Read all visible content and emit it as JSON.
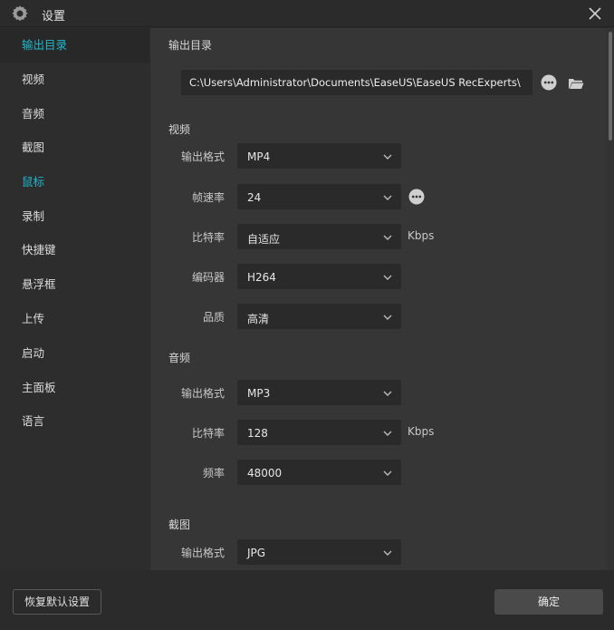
{
  "window": {
    "title": "设置",
    "app_icon": "gear-icon",
    "close_icon": "close-icon"
  },
  "sidebar": {
    "items": [
      {
        "label": "输出目录",
        "state": "selected"
      },
      {
        "label": "视频"
      },
      {
        "label": "音频"
      },
      {
        "label": "截图"
      },
      {
        "label": "鼠标",
        "state": "accent"
      },
      {
        "label": "录制"
      },
      {
        "label": "快捷键"
      },
      {
        "label": "悬浮框"
      },
      {
        "label": "上传"
      },
      {
        "label": "启动"
      },
      {
        "label": "主面板"
      },
      {
        "label": "语言"
      }
    ]
  },
  "output": {
    "title": "输出目录",
    "path": "C:\\Users\\Administrator\\Documents\\EaseUS\\EaseUS RecExperts\\",
    "more_icon": "more-icon",
    "folder_icon": "folder-icon"
  },
  "video": {
    "title": "视频",
    "format_label": "输出格式",
    "format_value": "MP4",
    "framerate_label": "帧速率",
    "framerate_value": "24",
    "bitrate_label": "比特率",
    "bitrate_value": "自适应",
    "bitrate_unit": "Kbps",
    "encoder_label": "编码器",
    "encoder_value": "H264",
    "quality_label": "品质",
    "quality_value": "高清"
  },
  "audio": {
    "title": "音频",
    "format_label": "输出格式",
    "format_value": "MP3",
    "bitrate_label": "比特率",
    "bitrate_value": "128",
    "bitrate_unit": "Kbps",
    "freq_label": "频率",
    "freq_value": "48000"
  },
  "screenshot": {
    "title": "截图",
    "format_label": "输出格式",
    "format_value": "JPG"
  },
  "footer": {
    "reset_label": "恢复默认设置",
    "ok_label": "确定"
  },
  "colors": {
    "accent": "#1fb8cc",
    "background": "#363636",
    "sidebar": "#2d2d2d"
  }
}
